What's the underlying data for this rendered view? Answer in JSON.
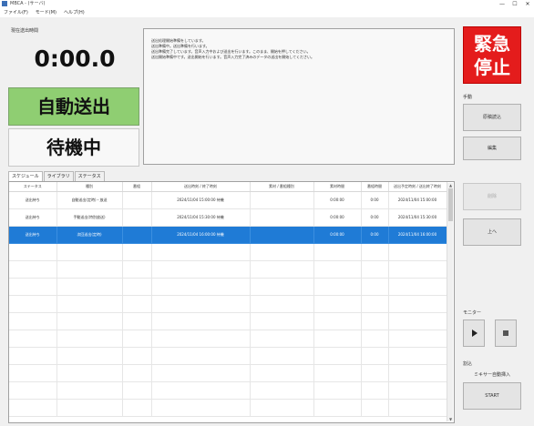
{
  "window": {
    "title": "MBCA - (サーバ)",
    "controls": [
      "—",
      "☐",
      "✕"
    ]
  },
  "menu": [
    "ファイル(F)",
    "モード(M)",
    "ヘルプ(H)"
  ],
  "left": {
    "elapsed_label": "現在送出時間",
    "timer": "0:00.0",
    "auto_send": "自動送出",
    "status": "待機中"
  },
  "log_lines": [
    "送出処理開始準備をしています。",
    "送出準備中。送出準備を行います。",
    "送出準備完了しています。音声入力中および送出を行います。このまま、開始を押してください。",
    "送出開始準備中です。送出開始を行います。音声入力完了済みのデータの送出を開始してください。"
  ],
  "emergency_stop": {
    "line1": "緊急",
    "line2": "停止"
  },
  "right": {
    "section_label": "手動",
    "btn_manual_read": "原稿読込",
    "btn_edit": "編集",
    "btn_delete": "削除",
    "btn_up": "上へ",
    "monitor_label": "モニター",
    "insert_label": "割込",
    "insert_caption": "ミキサー自動挿入",
    "start": "START"
  },
  "tabs": [
    "スケジュール",
    "ライブラリ",
    "ステータス"
  ],
  "table": {
    "columns": [
      "ステータス",
      "種別",
      "番組",
      "送出時刻 / 終了時刻",
      "素材 / 番組種別",
      "素材時間",
      "番組時間",
      "送出予定時刻 / 送出終了時刻"
    ],
    "rows": [
      [
        "送出待ち",
        "自動送出(定時)・放送",
        "",
        "2024/11/04 15:00:00 待機",
        "",
        "0:00:00",
        "0:00",
        "2024/11/04 15:00:00"
      ],
      [
        "送出待ち",
        "手動送出(特別放送)",
        "",
        "2024/11/04 15:30:00 待機",
        "",
        "0:00:00",
        "0:00",
        "2024/11/04 15:30:00"
      ],
      [
        "送出待ち",
        "次回送出(定時)",
        "",
        "2024/11/04 16:00:00 待機",
        "",
        "0:00:00",
        "0:00",
        "2024/11/04 16:00:00"
      ]
    ],
    "selected_index": 2
  },
  "colors": {
    "accent_blue": "#1f7bd6",
    "auto_send_green": "#8fce72",
    "emergency_red": "#e41c1c"
  }
}
